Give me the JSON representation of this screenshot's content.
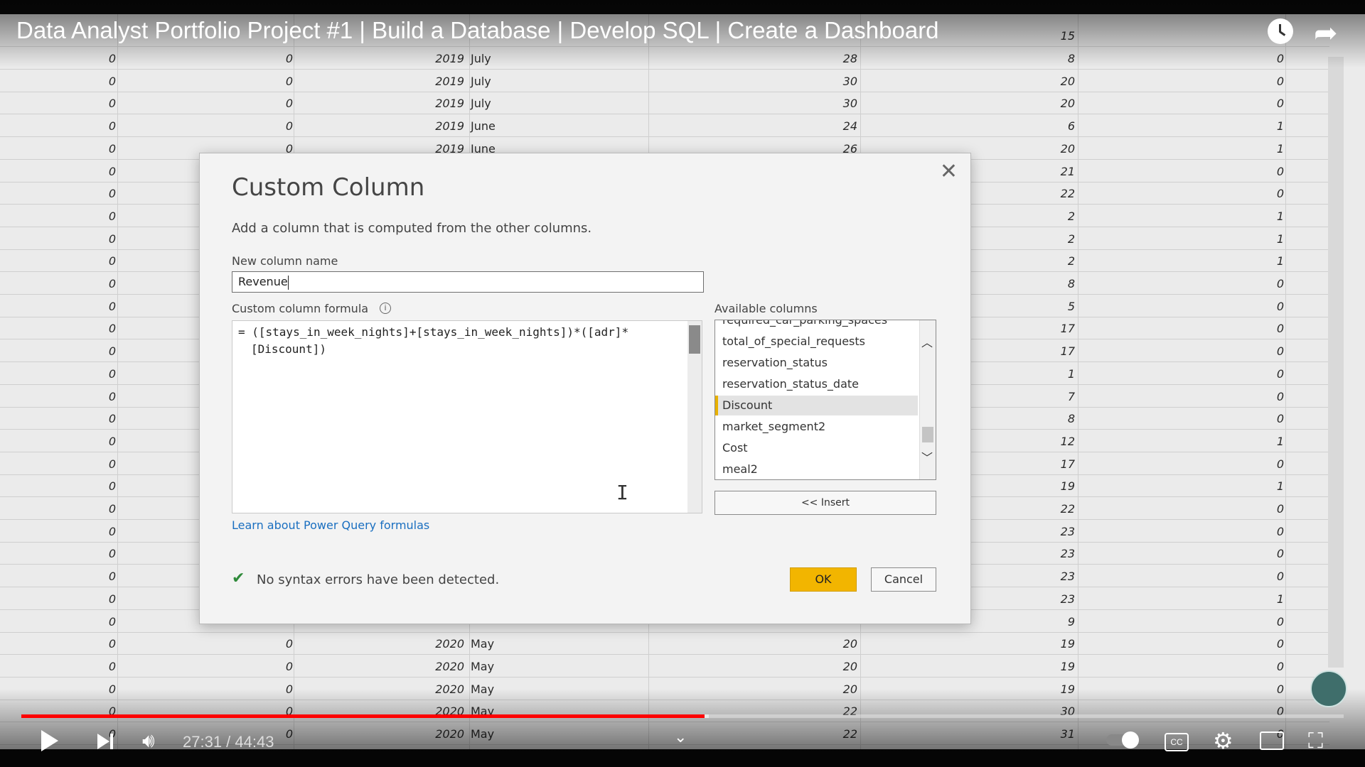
{
  "video": {
    "title": "Data Analyst Portfolio Project #1 | Build a Database | Develop SQL | Create a Dashboard",
    "time": "27:31 / 44:43",
    "played_fraction": 0.5165,
    "loaded_fraction": 0.52
  },
  "grid": {
    "rows": [
      [
        "0",
        "0",
        "2019",
        "July",
        "28",
        "8",
        "0"
      ],
      [
        "0",
        "0",
        "2019",
        "July",
        "30",
        "20",
        "0"
      ],
      [
        "0",
        "0",
        "2019",
        "July",
        "30",
        "20",
        "0"
      ],
      [
        "0",
        "0",
        "2019",
        "June",
        "24",
        "6",
        "1"
      ],
      [
        "0",
        "0",
        "2019",
        "June",
        "26",
        "20",
        "1"
      ],
      [
        "0",
        "",
        "",
        "",
        "",
        "21",
        "0"
      ],
      [
        "0",
        "",
        "",
        "",
        "",
        "22",
        "0"
      ],
      [
        "0",
        "",
        "",
        "",
        "",
        "2",
        "1"
      ],
      [
        "0",
        "",
        "",
        "",
        "",
        "2",
        "1"
      ],
      [
        "0",
        "",
        "",
        "",
        "",
        "2",
        "1"
      ],
      [
        "0",
        "",
        "",
        "",
        "",
        "8",
        "0"
      ],
      [
        "0",
        "",
        "",
        "",
        "",
        "5",
        "0"
      ],
      [
        "0",
        "",
        "",
        "",
        "",
        "17",
        "0"
      ],
      [
        "0",
        "",
        "",
        "",
        "",
        "17",
        "0"
      ],
      [
        "0",
        "",
        "",
        "",
        "",
        "1",
        "0"
      ],
      [
        "0",
        "",
        "",
        "",
        "",
        "7",
        "0"
      ],
      [
        "0",
        "",
        "",
        "",
        "",
        "8",
        "0"
      ],
      [
        "0",
        "",
        "",
        "",
        "",
        "12",
        "1"
      ],
      [
        "0",
        "",
        "",
        "",
        "",
        "17",
        "0"
      ],
      [
        "0",
        "",
        "",
        "",
        "",
        "19",
        "1"
      ],
      [
        "0",
        "",
        "",
        "",
        "",
        "22",
        "0"
      ],
      [
        "0",
        "",
        "",
        "",
        "",
        "23",
        "0"
      ],
      [
        "0",
        "",
        "",
        "",
        "",
        "23",
        "0"
      ],
      [
        "0",
        "",
        "",
        "",
        "",
        "23",
        "0"
      ],
      [
        "0",
        "",
        "",
        "",
        "",
        "23",
        "1"
      ],
      [
        "0",
        "",
        "",
        "",
        "",
        "9",
        "0"
      ],
      [
        "0",
        "0",
        "2020",
        "May",
        "20",
        "19",
        "0"
      ],
      [
        "0",
        "0",
        "2020",
        "May",
        "20",
        "19",
        "0"
      ],
      [
        "0",
        "0",
        "2020",
        "May",
        "20",
        "19",
        "0"
      ],
      [
        "0",
        "0",
        "2020",
        "May",
        "22",
        "30",
        "0"
      ],
      [
        "0",
        "0",
        "2020",
        "May",
        "22",
        "31",
        "0"
      ]
    ],
    "top_partial": "15"
  },
  "dialog": {
    "title": "Custom Column",
    "description": "Add a column that is computed from the other columns.",
    "name_label": "New column name",
    "name_value": "Revenue",
    "formula_label": "Custom column formula",
    "formula_line1": "= ([stays_in_week_nights]+[stays_in_week_nights])*([adr]*",
    "formula_line2": "[Discount])",
    "learn_link": "Learn about Power Query formulas",
    "available_label": "Available columns",
    "available_columns": [
      "required_car_parking_spaces",
      "total_of_special_requests",
      "reservation_status",
      "reservation_status_date",
      "Discount",
      "market_segment2",
      "Cost",
      "meal2"
    ],
    "selected_column": "Discount",
    "insert_label": "<< Insert",
    "status": "No syntax errors have been detected.",
    "ok_label": "OK",
    "cancel_label": "Cancel"
  },
  "icons": {
    "close": "close-icon",
    "info": "info-icon",
    "check": "check-icon",
    "scroll_up": "chevron-up-icon",
    "scroll_down": "chevron-down-icon"
  },
  "colors": {
    "ok_button": "#f2b500",
    "progress": "#ff0000",
    "link": "#1a6fc0",
    "check": "#2f8a3a"
  }
}
